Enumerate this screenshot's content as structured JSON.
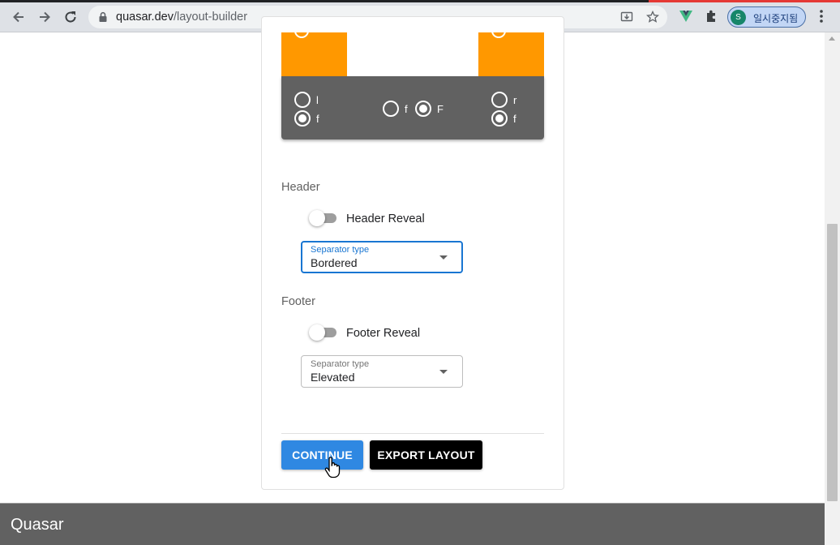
{
  "browser": {
    "url_domain": "quasar.dev",
    "url_path": "/layout-builder",
    "profile_initial": "S",
    "profile_status": "일시중지됨"
  },
  "preview": {
    "footer_left": {
      "options": [
        "l",
        "f"
      ],
      "selected": "f"
    },
    "footer_middle": {
      "options": [
        "f",
        "F"
      ],
      "selected": "F"
    },
    "footer_right": {
      "options": [
        "r",
        "f"
      ],
      "selected": "f"
    }
  },
  "header_section": {
    "title": "Header",
    "reveal_label": "Header Reveal",
    "reveal_on": false,
    "separator_label": "Separator type",
    "separator_value": "Bordered"
  },
  "footer_section": {
    "title": "Footer",
    "reveal_label": "Footer Reveal",
    "reveal_on": false,
    "separator_label": "Separator type",
    "separator_value": "Elevated"
  },
  "actions": {
    "continue_label": "CONTINUE",
    "export_label": "EXPORT LAYOUT"
  },
  "app_footer": {
    "title": "Quasar"
  },
  "colors": {
    "orange": "#ff9800",
    "footer_grey": "#616161",
    "primary": "#2f88e2",
    "focus_blue": "#1976d2"
  }
}
